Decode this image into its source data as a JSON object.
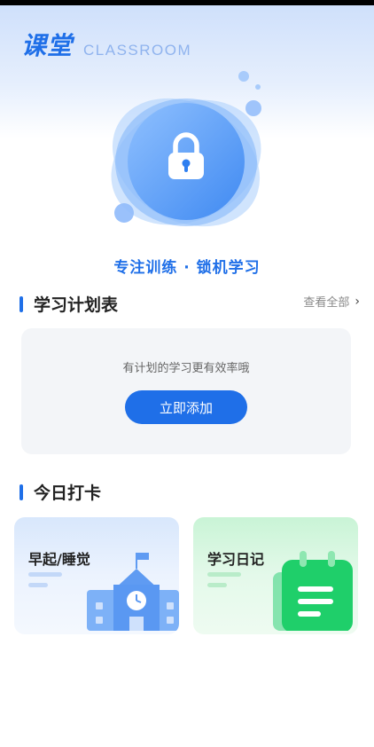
{
  "header": {
    "title_cn": "课堂",
    "title_en": "CLASSROOM"
  },
  "hero": {
    "tagline": "专注训练 · 锁机学习",
    "icon": "lock-icon"
  },
  "plan_section": {
    "title": "学习计划表",
    "view_all_label": "查看全部",
    "empty_hint": "有计划的学习更有效率哦",
    "add_button_label": "立即添加"
  },
  "checkin_section": {
    "title": "今日打卡",
    "cards": [
      {
        "label": "早起/睡觉",
        "icon": "school-clock-icon"
      },
      {
        "label": "学习日记",
        "icon": "notebook-icon"
      }
    ]
  },
  "colors": {
    "accent": "#1f6fe8",
    "card_bg": "#f3f5f8",
    "wake_card": "#d8e7fc",
    "diary_card": "#c9f4d6"
  }
}
